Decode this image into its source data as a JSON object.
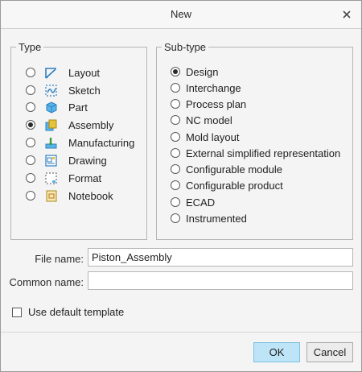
{
  "window": {
    "title": "New"
  },
  "type_group": {
    "legend": "Type",
    "items": [
      {
        "label": "Layout",
        "icon": "layout-icon",
        "selected": false
      },
      {
        "label": "Sketch",
        "icon": "sketch-icon",
        "selected": false
      },
      {
        "label": "Part",
        "icon": "part-icon",
        "selected": false
      },
      {
        "label": "Assembly",
        "icon": "assembly-icon",
        "selected": true
      },
      {
        "label": "Manufacturing",
        "icon": "manufacturing-icon",
        "selected": false
      },
      {
        "label": "Drawing",
        "icon": "drawing-icon",
        "selected": false
      },
      {
        "label": "Format",
        "icon": "format-icon",
        "selected": false
      },
      {
        "label": "Notebook",
        "icon": "notebook-icon",
        "selected": false
      }
    ]
  },
  "subtype_group": {
    "legend": "Sub-type",
    "items": [
      {
        "label": "Design",
        "selected": true
      },
      {
        "label": "Interchange",
        "selected": false
      },
      {
        "label": "Process plan",
        "selected": false
      },
      {
        "label": "NC model",
        "selected": false
      },
      {
        "label": "Mold layout",
        "selected": false
      },
      {
        "label": "External simplified representation",
        "selected": false
      },
      {
        "label": "Configurable module",
        "selected": false
      },
      {
        "label": "Configurable product",
        "selected": false
      },
      {
        "label": "ECAD",
        "selected": false
      },
      {
        "label": "Instrumented",
        "selected": false
      }
    ]
  },
  "fields": {
    "file_name_label": "File name:",
    "file_name_value": "Piston_Assembly",
    "common_name_label": "Common name:",
    "common_name_value": ""
  },
  "options": {
    "use_default_template_label": "Use default template",
    "use_default_template_checked": false
  },
  "buttons": {
    "ok": "OK",
    "cancel": "Cancel"
  },
  "colors": {
    "ok_button": "#bde4f7",
    "icon_blue": "#2f7fc1",
    "icon_yellow": "#e8c23a",
    "icon_green": "#3e9a3e"
  }
}
